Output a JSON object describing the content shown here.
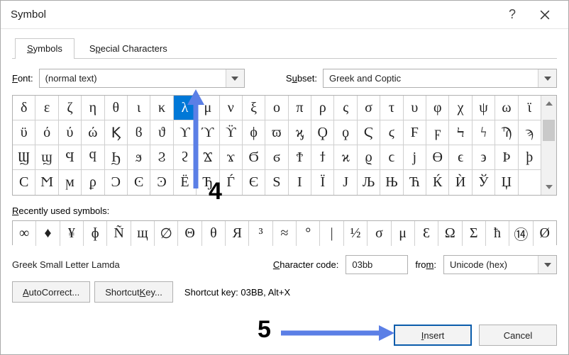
{
  "window": {
    "title": "Symbol"
  },
  "tabs": [
    {
      "prefix": "S",
      "rest": "ymbols"
    },
    {
      "prefix": "S",
      "mid": "p",
      "rest": "ecial Characters"
    }
  ],
  "font": {
    "prefix": "F",
    "rest": "ont:",
    "value": "(normal text)"
  },
  "subset": {
    "prefix": "S",
    "mid": "u",
    "rest": "bset:",
    "value": "Greek and Coptic"
  },
  "grid": [
    [
      "δ",
      "ε",
      "ζ",
      "η",
      "θ",
      "ι",
      "κ",
      "λ",
      "μ",
      "ν",
      "ξ",
      "ο",
      "π",
      "ρ",
      "ς",
      "σ",
      "τ",
      "υ",
      "φ",
      "χ",
      "ψ",
      "ω",
      "ϊ"
    ],
    [
      "ϋ",
      "ό",
      "ύ",
      "ώ",
      "Ϗ",
      "ϐ",
      "ϑ",
      "ϒ",
      "ϓ",
      "ϔ",
      "ϕ",
      "ϖ",
      "ϗ",
      "Ϙ",
      "ϙ",
      "Ϛ",
      "ϛ",
      "Ϝ",
      "ϝ",
      "Ϟ",
      "ϟ",
      "Ϡ",
      "ϡ"
    ],
    [
      "Ϣ",
      "ϣ",
      "Ϥ",
      "ϥ",
      "Ϧ",
      "ϧ",
      "Ϩ",
      "ϩ",
      "Ϫ",
      "ϫ",
      "Ϭ",
      "ϭ",
      "Ϯ",
      "ϯ",
      "ϰ",
      "ϱ",
      "ϲ",
      "ϳ",
      "ϴ",
      "ϵ",
      "϶",
      "Ϸ",
      "ϸ"
    ],
    [
      "Ϲ",
      "Ϻ",
      "ϻ",
      "ϼ",
      "Ͻ",
      "Ͼ",
      "Ͽ",
      "Ё",
      "Ђ",
      "Ѓ",
      "Є",
      "Ѕ",
      "І",
      "Ї",
      "Ј",
      "Љ",
      "Њ",
      "Ћ",
      "Ќ",
      "Ѝ",
      "Ў",
      "Џ",
      ""
    ]
  ],
  "selected": {
    "row": 0,
    "col": 7
  },
  "recent": {
    "prefix": "R",
    "rest": "ecently used symbols:",
    "items": [
      "∞",
      "♦",
      "¥",
      "ɸ",
      "Ñ",
      "щ",
      "∅",
      "Θ",
      "θ",
      "Я",
      "³",
      "≈",
      "°",
      "|",
      "½",
      "σ",
      "μ",
      "Ɛ",
      "Ω",
      "Σ",
      "ħ",
      "⑭",
      "Ø"
    ]
  },
  "symbolName": "Greek Small Letter Lamda",
  "charcode": {
    "label_pre": "C",
    "label_rest": "haracter code:",
    "value": "03bb"
  },
  "from": {
    "label_pre": "fro",
    "label_mid": "m",
    "label_post": ":",
    "value": "Unicode (hex)"
  },
  "autocorrect": {
    "pre": "A",
    "rest": "utoCorrect..."
  },
  "shortcutkey": {
    "pre": "Shortcut ",
    "mid": "K",
    "rest": "ey..."
  },
  "shortcut_hint": "Shortcut key: 03BB, Alt+X",
  "insert": {
    "pre": "I",
    "rest": "nsert"
  },
  "cancel": "Cancel",
  "annotations": {
    "four": "4",
    "five": "5"
  }
}
